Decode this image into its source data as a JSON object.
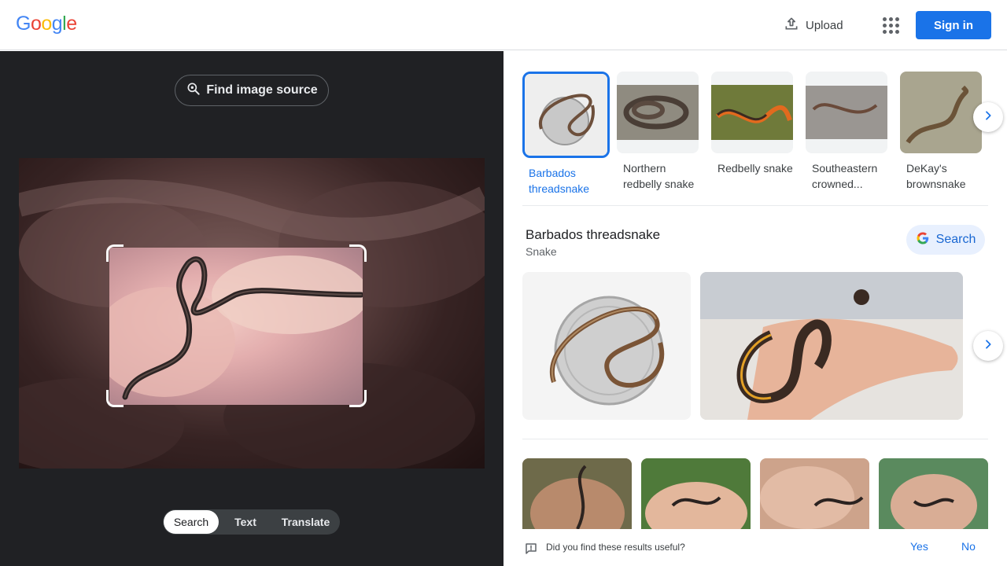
{
  "header": {
    "logo_letters": [
      {
        "ch": "G",
        "color": "#4285F4"
      },
      {
        "ch": "o",
        "color": "#EA4335"
      },
      {
        "ch": "o",
        "color": "#FBBC05"
      },
      {
        "ch": "g",
        "color": "#4285F4"
      },
      {
        "ch": "l",
        "color": "#34A853"
      },
      {
        "ch": "e",
        "color": "#EA4335"
      }
    ],
    "upload_label": "Upload",
    "upload_icon": "upload-icon",
    "apps_icon": "apps-grid-icon",
    "signin_label": "Sign in",
    "accent_color": "#1a73e8"
  },
  "left_panel": {
    "find_source_label": "Find image source",
    "find_source_icon": "lens-search-icon",
    "modes": [
      {
        "label": "Search",
        "active": true
      },
      {
        "label": "Text",
        "active": false
      },
      {
        "label": "Translate",
        "active": false
      }
    ],
    "background_color": "#202124"
  },
  "results": {
    "thumbnails": [
      {
        "label": "Barbados threadsnake",
        "selected": true
      },
      {
        "label": "Northern redbelly snake",
        "selected": false
      },
      {
        "label": "Redbelly snake",
        "selected": false
      },
      {
        "label": "Southeastern crowned...",
        "selected": false
      },
      {
        "label": "DeKay's brownsnake",
        "selected": false
      }
    ],
    "next_icon": "chevron-right-icon",
    "knowledge_panel": {
      "title": "Barbados threadsnake",
      "subtitle": "Snake",
      "search_label": "Search",
      "search_icon": "google-g-icon"
    }
  },
  "feedback": {
    "icon": "feedback-icon",
    "question": "Did you find these results useful?",
    "yes_label": "Yes",
    "no_label": "No"
  }
}
